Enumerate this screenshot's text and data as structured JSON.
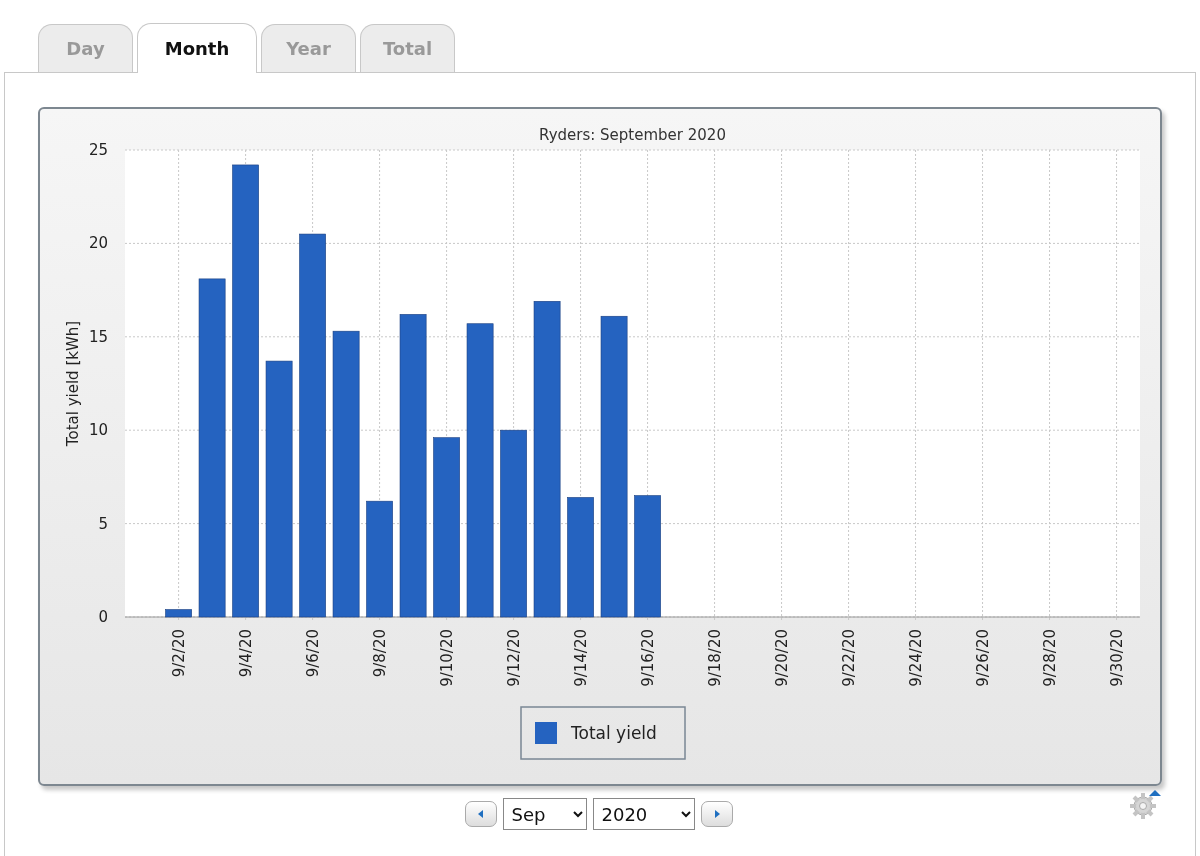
{
  "tabs": [
    {
      "label": "Day",
      "selected": false
    },
    {
      "label": "Month",
      "selected": true
    },
    {
      "label": "Year",
      "selected": false
    },
    {
      "label": "Total",
      "selected": false
    }
  ],
  "chart": {
    "chart_data": {
      "type": "bar",
      "title": "Ryders: September 2020",
      "ylabel": "Total yield [kWh]",
      "categories": [
        null,
        "9/2/20",
        null,
        "9/4/20",
        null,
        "9/6/20",
        null,
        "9/8/20",
        null,
        "9/10/20",
        null,
        "9/12/20",
        null,
        "9/14/20",
        null,
        "9/16/20",
        null,
        "9/18/20",
        null,
        "9/20/20",
        null,
        "9/22/20",
        null,
        "9/24/20",
        null,
        "9/26/20",
        null,
        "9/28/20",
        null,
        "9/30/20"
      ],
      "series": [
        {
          "name": "Total yield",
          "color": "#2563c0",
          "values": [
            null,
            0.4,
            18.1,
            24.2,
            13.7,
            20.5,
            15.3,
            6.2,
            16.2,
            9.6,
            15.7,
            10.0,
            16.9,
            6.4,
            16.1,
            6.5,
            null,
            null,
            null,
            null,
            null,
            null,
            null,
            null,
            null,
            null,
            null,
            null,
            null,
            null
          ]
        }
      ],
      "ylim": [
        0,
        25
      ],
      "yticks": [
        0,
        5,
        10,
        15,
        20,
        25
      ],
      "grid": true
    }
  },
  "controls": {
    "month": "Sep",
    "year": "2020"
  }
}
